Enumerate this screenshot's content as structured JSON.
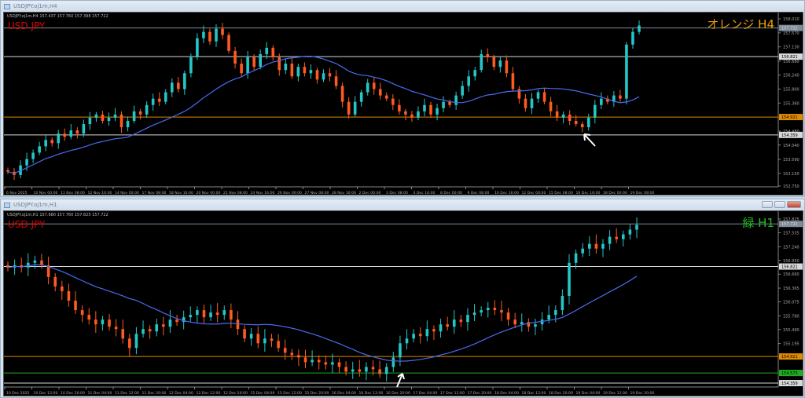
{
  "top": {
    "window_title": "USDJPY.oj1m,H4",
    "info_line": "USDJPY.oj1m,H4  157.437 157.760 157.398 157.722",
    "symbol_label": "USD JPY",
    "timeframe_label": "オレンジ H4",
    "timeframe_color": "#f0a000",
    "price_range": [
      152.75,
      158.01
    ],
    "price_ticks": [
      "158.010",
      "157.570",
      "157.130",
      "156.680",
      "156.240",
      "155.800",
      "155.360",
      "154.480",
      "154.040",
      "153.590",
      "153.150",
      "152.750"
    ],
    "price_tick_values": [
      158.01,
      157.57,
      157.13,
      156.68,
      156.24,
      155.8,
      155.36,
      154.48,
      154.04,
      153.59,
      153.15,
      152.75
    ],
    "levels": [
      {
        "price": 157.722,
        "label": "157.722",
        "color": "#7f8c99",
        "text": "#ddd"
      },
      {
        "price": 156.821,
        "label": "156.821",
        "color": "#d8d8d8",
        "text": "#000"
      },
      {
        "price": 154.921,
        "label": "154.921",
        "color": "#e08a00",
        "text": "#000"
      },
      {
        "price": 154.359,
        "label": "154.359",
        "color": "#d8d8d8",
        "text": "#000"
      }
    ],
    "time_labels": [
      "6 Nov 2025",
      "10 Nov 00:00",
      "11 Nov 08:00",
      "12 Nov 16:00",
      "14 Nov 00:00",
      "17 Nov 08:00",
      "18 Nov 16:00",
      "20 Nov 00:00",
      "21 Nov 08:00",
      "24 Nov 16:00",
      "26 Nov 00:00",
      "27 Nov 08:00",
      "28 Nov 16:00",
      "2 Dec 00:00",
      "3 Dec 08:00",
      "4 Dec 16:00",
      "8 Dec 00:00",
      "9 Dec 08:00",
      "10 Dec 16:00",
      "12 Dec 00:00",
      "15 Dec 08:00",
      "16 Dec 16:00",
      "18 Dec 00:00",
      "19 Dec 08:00"
    ],
    "closes": [
      153.2,
      153.1,
      153.4,
      153.6,
      153.8,
      154.0,
      154.2,
      154.1,
      154.4,
      154.3,
      154.5,
      154.4,
      154.7,
      154.9,
      155.0,
      154.8,
      154.9,
      155.0,
      154.6,
      154.8,
      155.1,
      155.0,
      155.3,
      155.5,
      155.4,
      155.7,
      156.0,
      155.8,
      156.3,
      156.8,
      157.4,
      157.6,
      157.3,
      157.7,
      157.5,
      157.0,
      156.6,
      156.3,
      156.8,
      156.5,
      156.9,
      157.1,
      156.8,
      156.4,
      156.6,
      156.2,
      156.5,
      156.3,
      156.4,
      156.1,
      156.3,
      156.2,
      155.9,
      155.4,
      155.0,
      155.4,
      155.7,
      156.0,
      155.8,
      155.6,
      155.5,
      155.3,
      155.1,
      155.0,
      154.9,
      155.1,
      155.3,
      155.0,
      155.2,
      155.4,
      155.3,
      155.6,
      155.9,
      156.2,
      156.4,
      156.9,
      156.8,
      156.5,
      156.7,
      156.3,
      155.8,
      155.5,
      155.2,
      155.5,
      155.7,
      155.4,
      155.1,
      154.9,
      155.0,
      154.8,
      154.7,
      154.6,
      154.9,
      155.3,
      155.5,
      155.4,
      155.6,
      155.5,
      157.2,
      157.6,
      157.8
    ],
    "arrow": "up-left-arrow"
  },
  "bottom": {
    "window_title": "USDJPY.oj1m,H1",
    "info_line": "USDJPY.oj1m,H1  157.680 157.760 157.625 157.722",
    "symbol_label": "USD JPY",
    "timeframe_label": "緑 H1",
    "timeframe_color": "#22bb22",
    "price_range": [
      154.359,
      157.825
    ],
    "price_ticks": [
      "157.825",
      "157.535",
      "157.240",
      "156.950",
      "156.660",
      "156.365",
      "156.075",
      "155.780",
      "155.490",
      "155.195"
    ],
    "price_tick_values": [
      157.825,
      157.535,
      157.24,
      156.95,
      156.66,
      156.365,
      156.075,
      155.78,
      155.49,
      155.195
    ],
    "levels": [
      {
        "price": 157.722,
        "label": "157.722",
        "color": "#7f8c99",
        "text": "#ddd"
      },
      {
        "price": 156.821,
        "label": "156.821",
        "color": "#d8d8d8",
        "text": "#000"
      },
      {
        "price": 154.921,
        "label": "154.921",
        "color": "#e08a00",
        "text": "#000"
      },
      {
        "price": 154.573,
        "label": "154.573",
        "color": "#22aa22",
        "text": "#000"
      },
      {
        "price": 154.359,
        "label": "154.359",
        "color": "#d8d8d8",
        "text": "#000"
      }
    ],
    "time_labels": [
      "10 Dec 2025",
      "10 Dec 12:00",
      "10 Dec 20:00",
      "11 Dec 04:00",
      "11 Dec 12:00",
      "11 Dec 20:00",
      "12 Dec 04:00",
      "12 Dec 12:00",
      "12 Dec 20:00",
      "15 Dec 04:00",
      "15 Dec 12:00",
      "15 Dec 20:00",
      "16 Dec 04:00",
      "16 Dec 12:00",
      "16 Dec 20:00",
      "17 Dec 04:00",
      "17 Dec 12:00",
      "17 Dec 20:00",
      "18 Dec 04:00",
      "18 Dec 12:00",
      "18 Dec 20:00",
      "19 Dec 04:00",
      "19 Dec 12:00",
      "19 Dec 20:00"
    ],
    "closes": [
      156.8,
      156.85,
      156.8,
      156.9,
      156.95,
      156.85,
      156.6,
      156.4,
      156.3,
      156.1,
      155.9,
      155.8,
      155.7,
      155.6,
      155.7,
      155.55,
      155.5,
      155.3,
      155.1,
      155.4,
      155.5,
      155.45,
      155.6,
      155.55,
      155.7,
      155.65,
      155.75,
      155.8,
      155.9,
      155.75,
      155.85,
      155.8,
      155.9,
      155.7,
      155.5,
      155.3,
      155.4,
      155.2,
      155.3,
      155.25,
      155.1,
      155.0,
      154.95,
      154.9,
      154.8,
      154.85,
      154.8,
      154.75,
      154.8,
      154.7,
      154.6,
      154.65,
      154.6,
      154.7,
      154.65,
      154.55,
      154.7,
      154.9,
      155.2,
      155.3,
      155.4,
      155.35,
      155.5,
      155.45,
      155.6,
      155.55,
      155.7,
      155.65,
      155.8,
      155.85,
      155.9,
      155.95,
      155.9,
      155.85,
      155.7,
      155.6,
      155.65,
      155.55,
      155.6,
      155.7,
      155.8,
      155.9,
      156.2,
      156.9,
      157.1,
      157.2,
      157.3,
      157.2,
      157.3,
      157.45,
      157.4,
      157.5,
      157.6,
      157.7
    ]
  }
}
